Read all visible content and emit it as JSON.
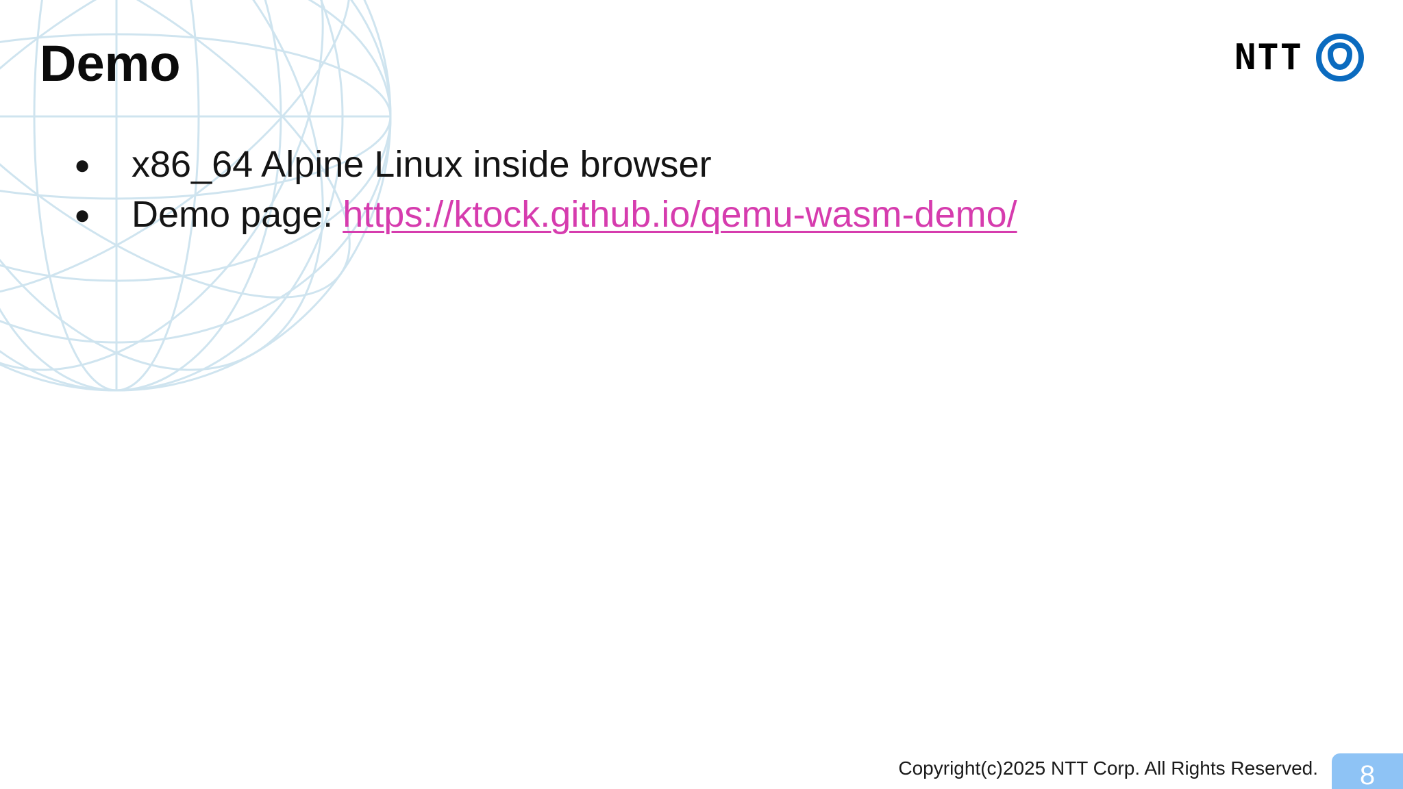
{
  "slide": {
    "title": "Demo",
    "bullets": [
      {
        "text": "x86_64 Alpine Linux inside browser"
      },
      {
        "label": "Demo page:",
        "link": "https://ktock.github.io/qemu-wasm-demo/"
      }
    ],
    "logo_text": "NTT",
    "copyright": "Copyright(c)2025 NTT Corp. All Rights Reserved.",
    "page_number": "8",
    "bullet_symbol": "●"
  },
  "colors": {
    "link": "#d63cae",
    "logo_blue": "#0b6bbf",
    "page_badge": "#8ec3f5",
    "globe_lines": "#a9cfe3"
  },
  "icons": {
    "logo_mark": "ntt-logo-icon",
    "background": "globe-icon"
  }
}
